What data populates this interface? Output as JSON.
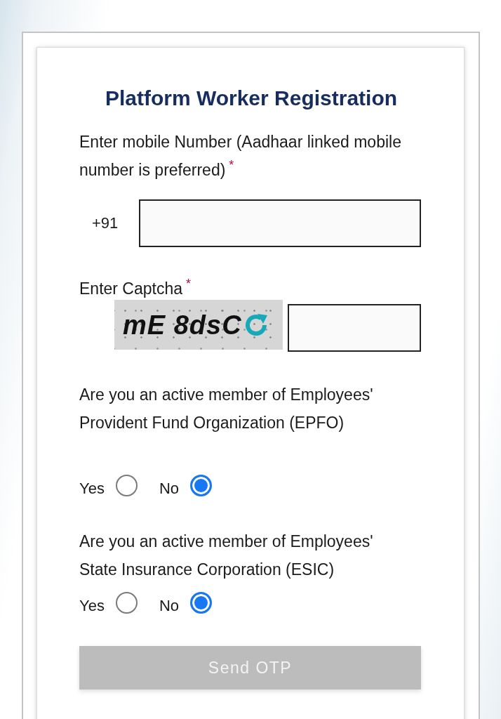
{
  "form": {
    "title": "Platform Worker Registration"
  },
  "mobile": {
    "label": "Enter mobile Number (Aadhaar linked mobile number is preferred)",
    "required_mark": "*",
    "prefix": "+91"
  },
  "captcha": {
    "label": "Enter Captcha",
    "required_mark": "*",
    "image_text": "mE 8dsC"
  },
  "questions": [
    {
      "text": "Are you an active member of Employees' Provident Fund Organization (EPFO)",
      "options": [
        {
          "label": "Yes",
          "selected": false
        },
        {
          "label": "No",
          "selected": true
        }
      ]
    },
    {
      "text": "Are you an active member of Employees' State Insurance Corporation (ESIC)",
      "options": [
        {
          "label": "Yes",
          "selected": false
        },
        {
          "label": "No",
          "selected": true
        }
      ]
    }
  ],
  "send_button": {
    "label": "Send OTP",
    "disabled": true
  }
}
